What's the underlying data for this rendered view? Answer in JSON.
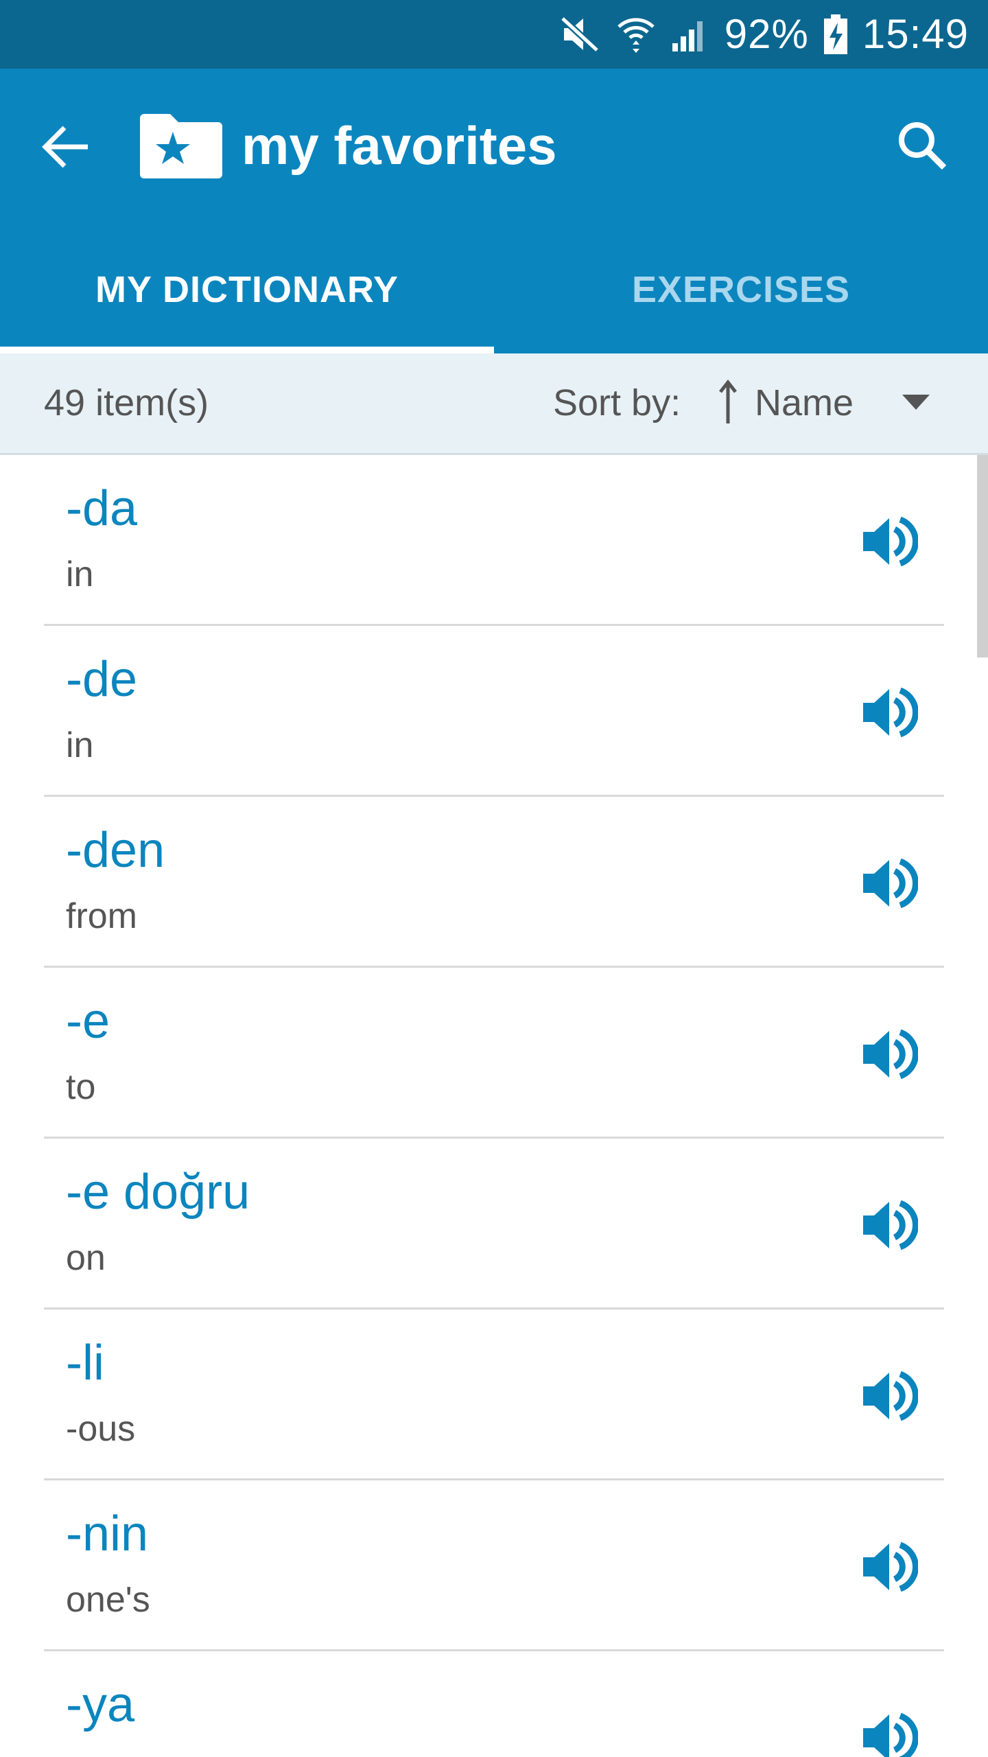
{
  "status_bar": {
    "battery_percent": "92%",
    "time": "15:49",
    "icons": [
      "mute-icon",
      "wifi-icon",
      "signal-icon",
      "battery-charging-icon"
    ]
  },
  "header": {
    "title": "my favorites",
    "back_icon": "arrow-back-icon",
    "folder_icon": "folder-star-icon",
    "search_icon": "search-icon"
  },
  "tabs": [
    {
      "label": "MY DICTIONARY",
      "active": true
    },
    {
      "label": "EXERCISES",
      "active": false
    }
  ],
  "sort_bar": {
    "item_count": "49 item(s)",
    "sort_label": "Sort by:",
    "sort_value": "Name",
    "sort_direction_icon": "sort-ascending-icon",
    "dropdown_icon": "dropdown-caret-icon"
  },
  "items": [
    {
      "word": "-da",
      "translation": "in"
    },
    {
      "word": "-de",
      "translation": "in"
    },
    {
      "word": "-den",
      "translation": "from"
    },
    {
      "word": "-e",
      "translation": "to"
    },
    {
      "word": "-e doğru",
      "translation": "on"
    },
    {
      "word": "-li",
      "translation": "-ous"
    },
    {
      "word": "-nin",
      "translation": "one's"
    },
    {
      "word": "-ya",
      "translation": ""
    }
  ],
  "colors": {
    "status_bar": "#0b6790",
    "app_bar": "#0b85be",
    "accent_text": "#0b85be",
    "secondary_text": "#555555",
    "sort_bar_bg": "#e7f1f6"
  }
}
